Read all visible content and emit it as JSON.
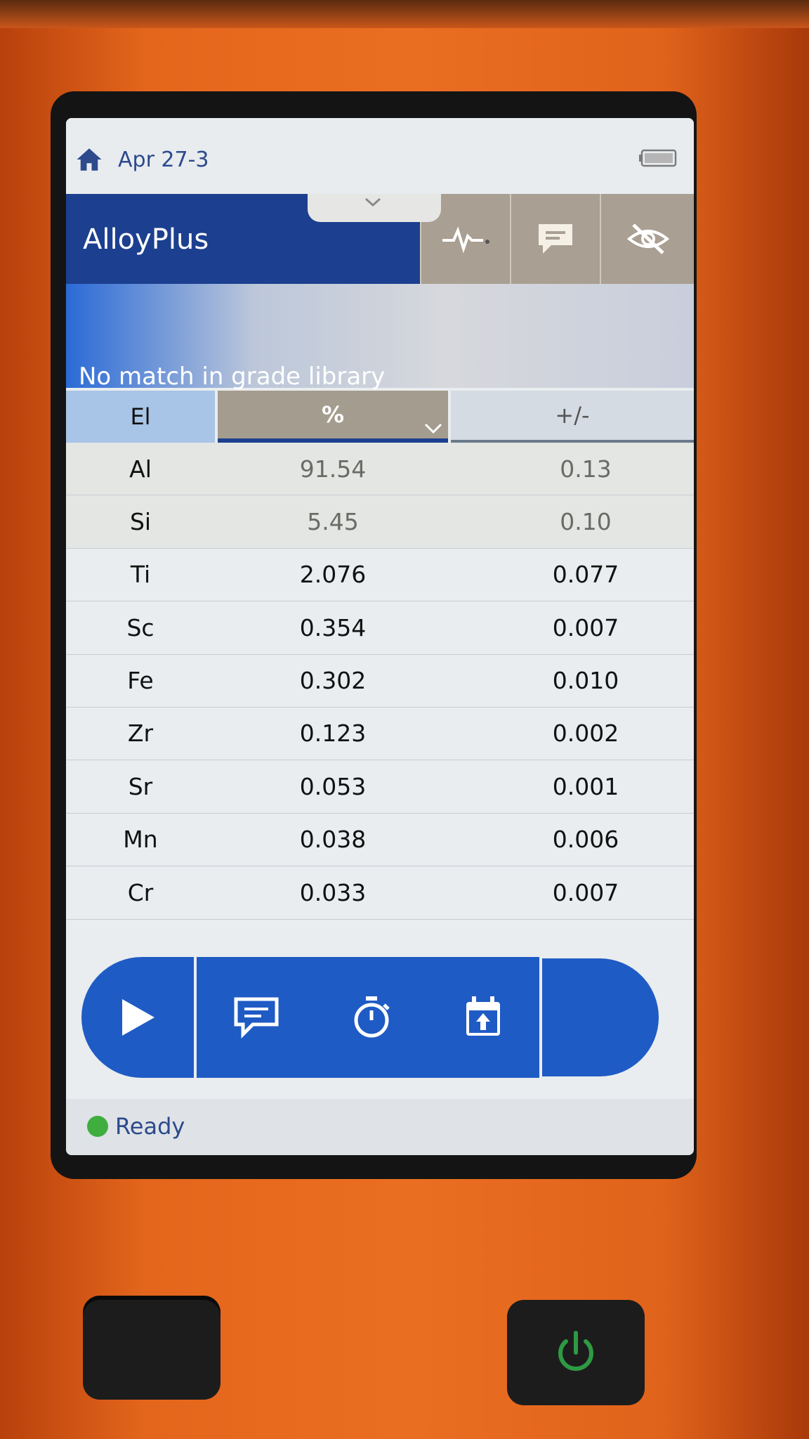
{
  "statusbar": {
    "title": "Apr 27-3",
    "home_icon": "home-icon",
    "battery_icon": "battery-icon"
  },
  "appbar": {
    "title": "AlloyPlus",
    "buttons": [
      {
        "icon": "spectrum-icon"
      },
      {
        "icon": "message-icon"
      },
      {
        "icon": "eye-off-icon"
      }
    ]
  },
  "banner": {
    "text": "No match in grade library"
  },
  "table": {
    "headers": {
      "element": "El",
      "percent": "%",
      "error": "+/-"
    },
    "rows": [
      {
        "el": "Al",
        "pct": "91.54",
        "err": "0.13"
      },
      {
        "el": "Si",
        "pct": "5.45",
        "err": "0.10"
      },
      {
        "el": "Ti",
        "pct": "2.076",
        "err": "0.077"
      },
      {
        "el": "Sc",
        "pct": "0.354",
        "err": "0.007"
      },
      {
        "el": "Fe",
        "pct": "0.302",
        "err": "0.010"
      },
      {
        "el": "Zr",
        "pct": "0.123",
        "err": "0.002"
      },
      {
        "el": "Sr",
        "pct": "0.053",
        "err": "0.001"
      },
      {
        "el": "Mn",
        "pct": "0.038",
        "err": "0.006"
      },
      {
        "el": "Cr",
        "pct": "0.033",
        "err": "0.007"
      }
    ]
  },
  "actionbar": {
    "icons": [
      "play-icon",
      "message-icon",
      "timer-icon",
      "calendar-upload-icon"
    ]
  },
  "footer": {
    "status": "Ready",
    "status_color": "#3fae3f"
  },
  "colors": {
    "brand_blue": "#1f5bc4",
    "header_blue": "#1c3f8f",
    "device_orange": "#e4661c"
  }
}
